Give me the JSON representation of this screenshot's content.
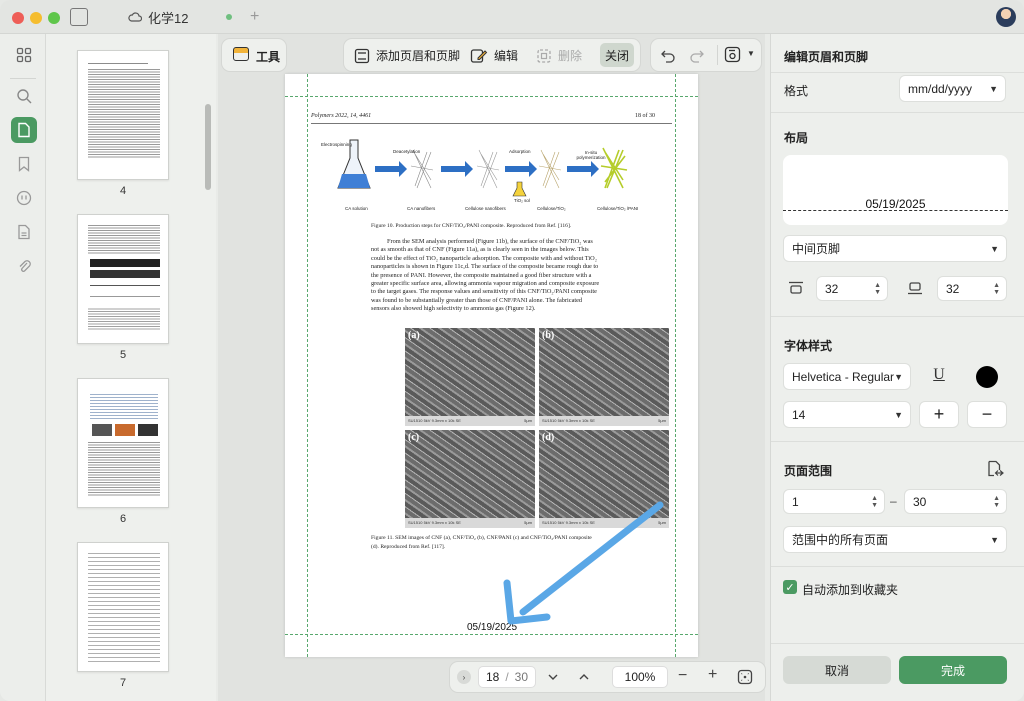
{
  "titlebar": {
    "tab_title": "化学12",
    "cloud_icon": "cloud-icon"
  },
  "toolbar": {
    "tools_label": "工具",
    "add_header_footer_label": "添加页眉和页脚",
    "edit_label": "编辑",
    "delete_label": "删除",
    "close_label": "关闭"
  },
  "thumbnails": [
    {
      "page": "4"
    },
    {
      "page": "5"
    },
    {
      "page": "6"
    },
    {
      "page": "7"
    }
  ],
  "document": {
    "header_left": "Polymers 2022, 14, 4461",
    "header_right": "18 of 30",
    "fig10_steps": [
      "CA solution",
      "CA nanofibers",
      "Cellulose nanofibers",
      "Cellulose/TiO₂",
      "Cellulose/TiO₂ /PANI"
    ],
    "fig10_arrows": [
      "Electrospinning",
      "Deacetylation",
      "Adsorption",
      "In-situ polymerization"
    ],
    "fig10_tio2": "TiO₂ sol",
    "fig10_caption": "Figure 10. Production steps for CNF/TiO₂/PANI composite. Reproduced from Ref. [116].",
    "body_lines": [
      "From the SEM analysis performed (Figure 11b), the surface of the CNF/TiO₂ was",
      "not as smooth as that of CNF (Figure 11a), as is clearly seen in the images below. This",
      "could be the effect of TiO₂ nanoparticle adsorption. The composite with and without TiO₂",
      "nanoparticles is shown in Figure 11c,d. The surface of the composite became rough due to",
      "the presence of PANI. However, the composite maintained a good fiber structure with a",
      "greater specific surface area, allowing ammonia vapour migration and composite exposure",
      "to the target gases. The response values and sensitivity of this CNF/TiO₂/PANI composite",
      "was found to be substantially greater than those of CNF/PANI alone. The fabricated",
      "sensors also showed high selectivity to ammonia gas (Figure 12)."
    ],
    "sem_panels": [
      {
        "label": "(a)",
        "bar": "SU1510 5kV 9.3mm x 10k SE",
        "scale": "5μm"
      },
      {
        "label": "(b)",
        "bar": "SU1510 5kV 9.3mm x 10k SE",
        "scale": "5μm"
      },
      {
        "label": "(c)",
        "bar": "SU1510 5kV 9.3mm x 10k SE",
        "scale": "5μm"
      },
      {
        "label": "(d)",
        "bar": "SU1510 5kV 9.3mm x 10k SE",
        "scale": "5μm"
      }
    ],
    "fig11_caption_1": "Figure 11. SEM images of CNF (a), CNF/TiO₂ (b), CNF/PANI (c) and CNF/TiO₂/PANI composite",
    "fig11_caption_2": "(d). Reproduced from Ref. [117].",
    "footer_date": "05/19/2025"
  },
  "pager": {
    "current_page": "18",
    "separator": "/",
    "total_pages": "30",
    "zoom": "100%"
  },
  "panel": {
    "title": "编辑页眉和页脚",
    "format_label": "格式",
    "format_value": "mm/dd/yyyy",
    "layout_label": "布局",
    "preview_date": "05/19/2025",
    "position_value": "中间页脚",
    "top_margin": "32",
    "bottom_margin": "32",
    "font_style_label": "字体样式",
    "font_value": "Helvetica - Regular",
    "font_size": "14",
    "font_color": "#000000",
    "page_range_label": "页面范围",
    "range_from": "1",
    "range_dash": "–",
    "range_to": "30",
    "range_mode": "范围中的所有页面",
    "auto_bookmark_label": "自动添加到收藏夹",
    "auto_bookmark_checked": true,
    "cancel_label": "取消",
    "done_label": "完成"
  },
  "colors": {
    "accent": "#4b9a62",
    "guide": "#58a86d",
    "annotation_arrow": "#5aa7e6"
  }
}
